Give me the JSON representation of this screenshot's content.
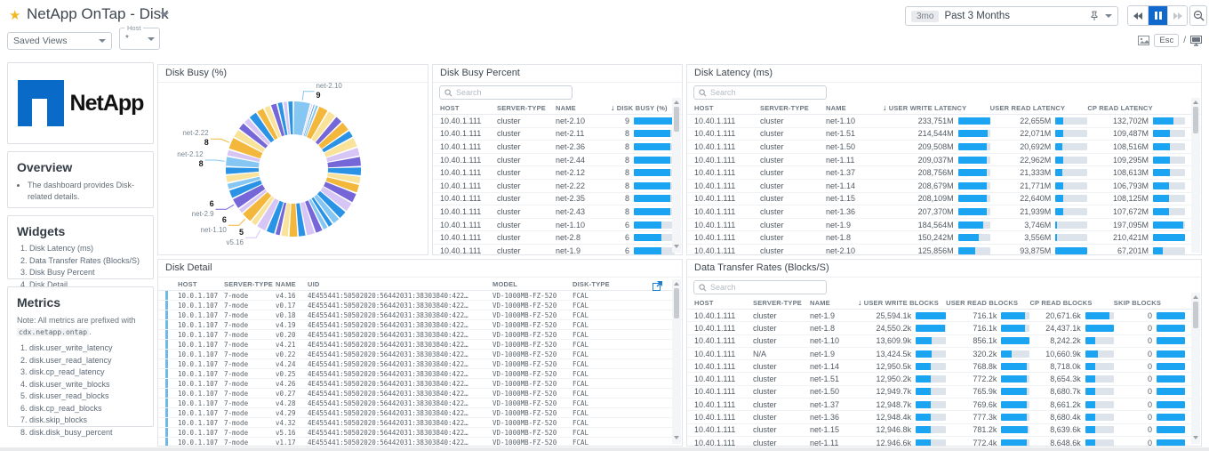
{
  "header": {
    "title": "NetApp OnTap - Disk",
    "star": "★",
    "time_badge": "3mo",
    "time_label": "Past 3 Months",
    "esc_label": "Esc",
    "slash": "/"
  },
  "toolbar": {
    "saved_views_label": "Saved Views",
    "host_label": "Host",
    "host_value": "*"
  },
  "sidebar": {
    "brand": "NetApp",
    "overview": {
      "title": "Overview",
      "bullets": [
        "The dashboard provides Disk-related details."
      ]
    },
    "widgets": {
      "title": "Widgets",
      "items": [
        "Disk Latency (ms)",
        "Data Transfer Rates (Blocks/S)",
        "Disk Busy Percent",
        "Disk Detail"
      ]
    },
    "metrics": {
      "title": "Metrics",
      "note_prefix": "Note: All metrics are prefixed with",
      "note_code": "cdx.netapp.ontap",
      "note_suffix": ".",
      "items": [
        "disk.user_write_latency",
        "disk.user_read_latency",
        "disk.cp_read_latency",
        "disk.user_write_blocks",
        "disk.user_read_blocks",
        "disk.cp_read_blocks",
        "disk.skip_blocks",
        "disk.disk_busy_percent"
      ]
    }
  },
  "panels": {
    "donut": {
      "title": "Disk Busy (%)"
    },
    "busy": {
      "title": "Disk Busy Percent",
      "search_placeholder": "Search",
      "sort_indicator": "↓",
      "columns": [
        "HOST",
        "SERVER-TYPE",
        "NAME",
        "DISK BUSY (%)"
      ],
      "rows": [
        {
          "host": "10.40.1.111",
          "server": "cluster",
          "name": "net-2.10",
          "busy": "9"
        },
        {
          "host": "10.40.1.111",
          "server": "cluster",
          "name": "net-2.11",
          "busy": "8"
        },
        {
          "host": "10.40.1.111",
          "server": "cluster",
          "name": "net-2.36",
          "busy": "8"
        },
        {
          "host": "10.40.1.111",
          "server": "cluster",
          "name": "net-2.44",
          "busy": "8"
        },
        {
          "host": "10.40.1.111",
          "server": "cluster",
          "name": "net-2.12",
          "busy": "8"
        },
        {
          "host": "10.40.1.111",
          "server": "cluster",
          "name": "net-2.22",
          "busy": "8"
        },
        {
          "host": "10.40.1.111",
          "server": "cluster",
          "name": "net-2.35",
          "busy": "8"
        },
        {
          "host": "10.40.1.111",
          "server": "cluster",
          "name": "net-2.43",
          "busy": "8"
        },
        {
          "host": "10.40.1.111",
          "server": "cluster",
          "name": "net-1.10",
          "busy": "6"
        },
        {
          "host": "10.40.1.111",
          "server": "cluster",
          "name": "net-2.8",
          "busy": "6"
        },
        {
          "host": "10.40.1.111",
          "server": "cluster",
          "name": "net-1.9",
          "busy": "6"
        }
      ]
    },
    "latency": {
      "title": "Disk Latency (ms)",
      "search_placeholder": "Search",
      "sort_indicator": "↓",
      "columns": [
        "HOST",
        "SERVER-TYPE",
        "NAME",
        "USER WRITE LATENCY",
        "USER READ LATENCY",
        "CP READ LATENCY"
      ],
      "rows": [
        {
          "host": "10.40.1.111",
          "server": "cluster",
          "name": "net-1.10",
          "write": "233,751M",
          "read": "22,655M",
          "cp": "132,702M"
        },
        {
          "host": "10.40.1.111",
          "server": "cluster",
          "name": "net-1.51",
          "write": "214,544M",
          "read": "22,071M",
          "cp": "109,487M"
        },
        {
          "host": "10.40.1.111",
          "server": "cluster",
          "name": "net-1.50",
          "write": "209,508M",
          "read": "20,692M",
          "cp": "108,516M"
        },
        {
          "host": "10.40.1.111",
          "server": "cluster",
          "name": "net-1.11",
          "write": "209,037M",
          "read": "22,962M",
          "cp": "109,295M"
        },
        {
          "host": "10.40.1.111",
          "server": "cluster",
          "name": "net-1.37",
          "write": "208,756M",
          "read": "21,333M",
          "cp": "108,613M"
        },
        {
          "host": "10.40.1.111",
          "server": "cluster",
          "name": "net-1.14",
          "write": "208,679M",
          "read": "21,771M",
          "cp": "106,793M"
        },
        {
          "host": "10.40.1.111",
          "server": "cluster",
          "name": "net-1.15",
          "write": "208,109M",
          "read": "22,640M",
          "cp": "108,125M"
        },
        {
          "host": "10.40.1.111",
          "server": "cluster",
          "name": "net-1.36",
          "write": "207,370M",
          "read": "21,939M",
          "cp": "107,672M"
        },
        {
          "host": "10.40.1.111",
          "server": "cluster",
          "name": "net-1.9",
          "write": "184,564M",
          "read": "3,746M",
          "cp": "197,095M"
        },
        {
          "host": "10.40.1.111",
          "server": "cluster",
          "name": "net-1.8",
          "write": "150,242M",
          "read": "3,556M",
          "cp": "210,421M"
        },
        {
          "host": "10.40.1.111",
          "server": "cluster",
          "name": "net-2.10",
          "write": "125,856M",
          "read": "93,875M",
          "cp": "67,201M"
        }
      ]
    },
    "transfer": {
      "title": "Data Transfer Rates (Blocks/S)",
      "search_placeholder": "Search",
      "sort_indicator": "↓",
      "columns": [
        "HOST",
        "SERVER-TYPE",
        "NAME",
        "USER WRITE BLOCKS",
        "USER READ BLOCKS",
        "CP READ BLOCKS",
        "SKIP BLOCKS"
      ],
      "rows": [
        {
          "host": "10.40.1.111",
          "server": "cluster",
          "name": "net-1.9",
          "write": "25,594.1k",
          "read": "716.1k",
          "cp": "20,671.6k",
          "skip": "0"
        },
        {
          "host": "10.40.1.111",
          "server": "cluster",
          "name": "net-1.8",
          "write": "24,550.2k",
          "read": "716.1k",
          "cp": "24,437.1k",
          "skip": "0"
        },
        {
          "host": "10.40.1.111",
          "server": "cluster",
          "name": "net-1.10",
          "write": "13,609.9k",
          "read": "856.1k",
          "cp": "8,242.2k",
          "skip": "0"
        },
        {
          "host": "10.40.1.111",
          "server": "N/A",
          "name": "net-1.9",
          "write": "13,424.5k",
          "read": "320.2k",
          "cp": "10,660.9k",
          "skip": "0"
        },
        {
          "host": "10.40.1.111",
          "server": "cluster",
          "name": "net-1.14",
          "write": "12,950.5k",
          "read": "768.8k",
          "cp": "8,718.0k",
          "skip": "0"
        },
        {
          "host": "10.40.1.111",
          "server": "cluster",
          "name": "net-1.51",
          "write": "12,950.2k",
          "read": "772.2k",
          "cp": "8,654.3k",
          "skip": "0"
        },
        {
          "host": "10.40.1.111",
          "server": "cluster",
          "name": "net-1.50",
          "write": "12,949.7k",
          "read": "765.9k",
          "cp": "8,680.7k",
          "skip": "0"
        },
        {
          "host": "10.40.1.111",
          "server": "cluster",
          "name": "net-1.37",
          "write": "12,948.7k",
          "read": "769.6k",
          "cp": "8,661.2k",
          "skip": "0"
        },
        {
          "host": "10.40.1.111",
          "server": "cluster",
          "name": "net-1.36",
          "write": "12,948.4k",
          "read": "777.3k",
          "cp": "8,680.4k",
          "skip": "0"
        },
        {
          "host": "10.40.1.111",
          "server": "cluster",
          "name": "net-1.15",
          "write": "12,946.8k",
          "read": "781.2k",
          "cp": "8,639.6k",
          "skip": "0"
        },
        {
          "host": "10.40.1.111",
          "server": "cluster",
          "name": "net-1.11",
          "write": "12,946.6k",
          "read": "772.4k",
          "cp": "8,648.6k",
          "skip": "0"
        }
      ]
    },
    "detail": {
      "title": "Disk Detail",
      "columns": [
        "HOST",
        "SERVER-TYPE",
        "NAME",
        "UID",
        "MODEL",
        "DISK-TYPE"
      ],
      "uid": "4E455441:50502020:56442031:38303840:422…",
      "model": "VD-1000MB-FZ-520",
      "disk_type": "FCAL",
      "host": "10.0.1.107",
      "server": "7-mode",
      "names": [
        "v4.16",
        "v0.17",
        "v0.18",
        "v4.19",
        "v0.20",
        "v4.21",
        "v0.22",
        "v4.24",
        "v0.25",
        "v4.26",
        "v0.27",
        "v4.28",
        "v4.29",
        "v4.32",
        "v5.16",
        "v1.17"
      ]
    }
  },
  "chart_data": {
    "type": "pie",
    "title": "Disk Busy (%)",
    "legend_position": "none",
    "note": "donut of per-disk busy percent; only six slices carry callout labels",
    "labeled_slices": [
      {
        "name": "net-2.10",
        "value": 9
      },
      {
        "name": "net-2.22",
        "value": 8
      },
      {
        "name": "net-2.12",
        "value": 8
      },
      {
        "name": "net-2.9",
        "value": 6
      },
      {
        "name": "net-1.10",
        "value": 6
      },
      {
        "name": "v5.16",
        "value": 5
      }
    ],
    "slices": [
      {
        "c": "lb",
        "d": 15,
        "name": "net-2.10",
        "value": 9
      },
      {
        "c": "lv",
        "d": 2
      },
      {
        "c": "bl",
        "d": 2
      },
      {
        "c": "lb",
        "d": 3
      },
      {
        "c": "gd",
        "d": 9
      },
      {
        "c": "py",
        "d": 8
      },
      {
        "c": "pu",
        "d": 7
      },
      {
        "c": "gd",
        "d": 9
      },
      {
        "c": "bl",
        "d": 7
      },
      {
        "c": "py",
        "d": 9
      },
      {
        "c": "lv",
        "d": 8
      },
      {
        "c": "pu",
        "d": 9
      },
      {
        "c": "bl",
        "d": 8
      },
      {
        "c": "py",
        "d": 7
      },
      {
        "c": "gd",
        "d": 8
      },
      {
        "c": "pu",
        "d": 9
      },
      {
        "c": "lv",
        "d": 9
      },
      {
        "c": "bl",
        "d": 8
      },
      {
        "c": "lb",
        "d": 7
      },
      {
        "c": "bl",
        "d": 5
      },
      {
        "c": "lb",
        "d": 5
      },
      {
        "c": "pu",
        "d": 7
      },
      {
        "c": "lv",
        "d": 8
      },
      {
        "c": "bl",
        "d": 7
      },
      {
        "c": "gd",
        "d": 8
      },
      {
        "c": "py",
        "d": 7
      },
      {
        "c": "pu",
        "d": 5
      },
      {
        "c": "bl",
        "d": 8
      },
      {
        "c": "lv",
        "d": 9,
        "name": "v5.16",
        "value": 5
      },
      {
        "c": "py",
        "d": 6
      },
      {
        "c": "gd",
        "d": 10,
        "name": "net-1.10",
        "value": 6
      },
      {
        "c": "lv",
        "d": 5
      },
      {
        "c": "pu",
        "d": 10,
        "name": "net-2.9",
        "value": 6
      },
      {
        "c": "bl",
        "d": 8
      },
      {
        "c": "lb",
        "d": 6
      },
      {
        "c": "py",
        "d": 7
      },
      {
        "c": "bl",
        "d": 7
      },
      {
        "c": "lb",
        "d": 9,
        "name": "net-2.12",
        "value": 8
      },
      {
        "c": "lv",
        "d": 6
      },
      {
        "c": "gd",
        "d": 11,
        "name": "net-2.22",
        "value": 8
      },
      {
        "c": "py",
        "d": 8
      },
      {
        "c": "pu",
        "d": 7
      },
      {
        "c": "lv",
        "d": 6
      },
      {
        "c": "bl",
        "d": 8
      },
      {
        "c": "gd",
        "d": 7
      },
      {
        "c": "py",
        "d": 6
      },
      {
        "c": "pu",
        "d": 6
      },
      {
        "c": "bl",
        "d": 5
      },
      {
        "c": "lv",
        "d": 4
      },
      {
        "c": "bl",
        "d": 5
      }
    ]
  },
  "colors": {
    "accent_bar": "#1ba4f1",
    "bar_track": "#dde3ea",
    "pause_active": "#1169cd",
    "star": "#f2b824",
    "brand_blue": "#0a6ac8",
    "palette": {
      "lb": "#85c6f2",
      "bl": "#2a93e5",
      "gd": "#f3b73c",
      "py": "#f9e39b",
      "pu": "#7667d8",
      "lv": "#d7c6f5"
    }
  }
}
